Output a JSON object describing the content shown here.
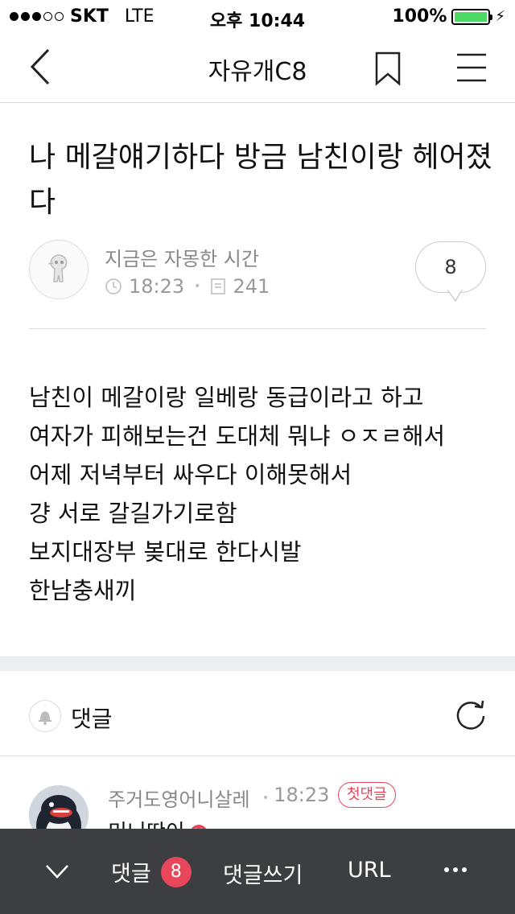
{
  "status_bar": {
    "carrier": "SKT",
    "network": "LTE",
    "time": "오후 10:44",
    "battery": "100%",
    "battery_level": 1.0
  },
  "nav": {
    "title": "자유개C8",
    "back_icon": "chevron-left-icon",
    "bookmark_icon": "bookmark-icon",
    "menu_icon": "hamburger-menu-icon"
  },
  "post": {
    "title": "나 메갈얘기하다 방금 남친이랑 헤어졌다",
    "author": "지금은 자몽한 시간",
    "time": "18:23",
    "views": "241",
    "comment_count": "8",
    "body_lines": [
      "남친이 메갈이랑 일베랑 동급이라고 하고",
      "여자가 피해보는건 도대체 뭐냐 ㅇㅈㄹ해서",
      "어제 저녁부터 싸우다 이해못해서",
      "걍 서로 갈길가기로함",
      "보지대장부 봊대로 한다시발",
      "한남충새끼"
    ]
  },
  "comments": {
    "label": "댓글",
    "items": [
      {
        "name": "주거도영어니살레",
        "time": "18:23",
        "badge": "첫댓글",
        "text": "미니딴이",
        "new_badge": "N"
      }
    ]
  },
  "toolbar": {
    "comments_label": "댓글",
    "comments_count": "8",
    "write_label": "댓글쓰기",
    "url_label": "URL"
  },
  "colors": {
    "accent": "#e8475b",
    "toolbar_bg": "#3d3e42",
    "battery": "#4cd964"
  }
}
